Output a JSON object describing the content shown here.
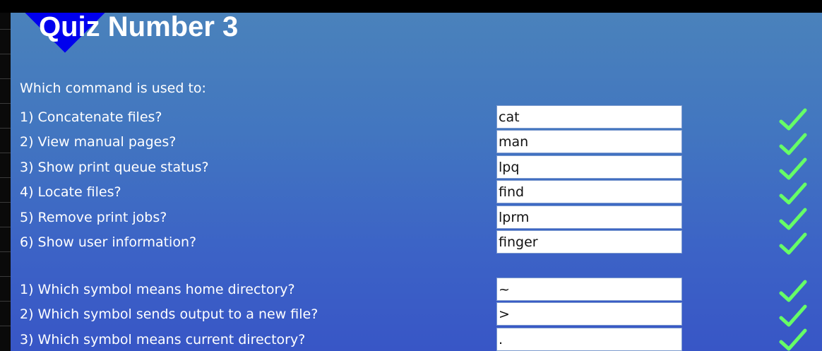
{
  "quiz": {
    "title": "Quiz Number 3",
    "intro": "Which command is used to:",
    "commands": [
      {
        "question": "1) Concatenate files?",
        "answer": "cat",
        "correct": true
      },
      {
        "question": "2) View manual pages?",
        "answer": "man",
        "correct": true
      },
      {
        "question": "3) Show print queue status?",
        "answer": "lpq",
        "correct": true
      },
      {
        "question": "4) Locate files?",
        "answer": "find",
        "correct": true
      },
      {
        "question": "5) Remove print jobs?",
        "answer": "lprm",
        "correct": true
      },
      {
        "question": "6) Show user information?",
        "answer": "finger",
        "correct": true
      }
    ],
    "symbols": [
      {
        "question": "1) Which symbol means home directory?",
        "answer": "~",
        "correct": true
      },
      {
        "question": "2) Which symbol sends output to a new file?",
        "answer": ">",
        "correct": true
      },
      {
        "question": "3) Which symbol means current directory?",
        "answer": ".",
        "correct": true
      }
    ]
  },
  "icons": {
    "check": "check-icon",
    "check_color": "#66ff66",
    "diamond_color": "#0000ee"
  }
}
